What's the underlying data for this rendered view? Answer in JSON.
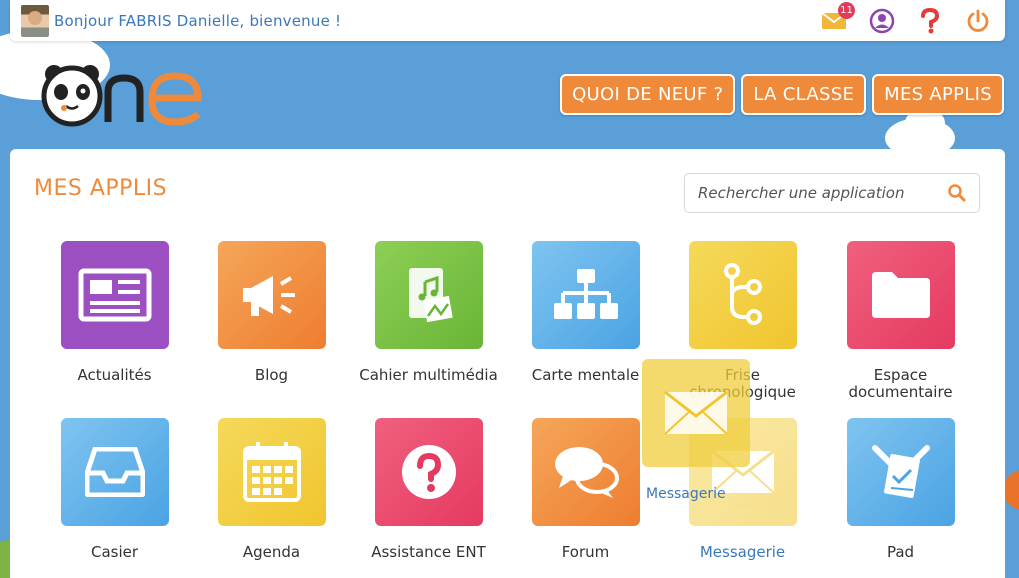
{
  "topbar": {
    "greeting": "Bonjour FABRIS Danielle, bienvenue !",
    "notification_count": "11",
    "icons": [
      "avatar",
      "mail-icon",
      "user-icon",
      "help-icon",
      "power-icon"
    ]
  },
  "logo_text": "one",
  "nav": [
    {
      "label": "QUOI DE NEUF ?"
    },
    {
      "label": "LA CLASSE"
    },
    {
      "label": "MES APPLIS"
    }
  ],
  "main": {
    "title": "MES APPLIS",
    "search_placeholder": "Rechercher une application"
  },
  "apps": [
    {
      "label": "Actualités",
      "icon": "newspaper-icon",
      "color": "#9b4fc0"
    },
    {
      "label": "Blog",
      "icon": "megaphone-icon",
      "color": "#f08a3b"
    },
    {
      "label": "Cahier multimédia",
      "icon": "notebook-icon",
      "color": "#7cc142"
    },
    {
      "label": "Carte mentale",
      "icon": "sitemap-icon",
      "color": "#5aaeea"
    },
    {
      "label": "Frise chronologique",
      "icon": "timeline-icon",
      "color": "#f2cc3a"
    },
    {
      "label": "Espace documentaire",
      "icon": "folder-icon",
      "color": "#e8446a"
    },
    {
      "label": "Casier",
      "icon": "tray-icon",
      "color": "#5aaeea"
    },
    {
      "label": "Agenda",
      "icon": "calendar-icon",
      "color": "#f2cc3a"
    },
    {
      "label": "Assistance ENT",
      "icon": "help-circle-icon",
      "color": "#e8446a"
    },
    {
      "label": "Forum",
      "icon": "chat-icon",
      "color": "#f08a3b"
    },
    {
      "label": "Messagerie",
      "icon": "envelope-icon",
      "color": "#f2cc3a"
    },
    {
      "label": "Pad",
      "icon": "pad-icon",
      "color": "#5aaeea"
    }
  ],
  "dragging": {
    "label": "Messagerie",
    "icon": "envelope-icon"
  },
  "colors": {
    "accent": "#f08a3b",
    "sky": "#5a9fd8",
    "link": "#3a78bd"
  }
}
